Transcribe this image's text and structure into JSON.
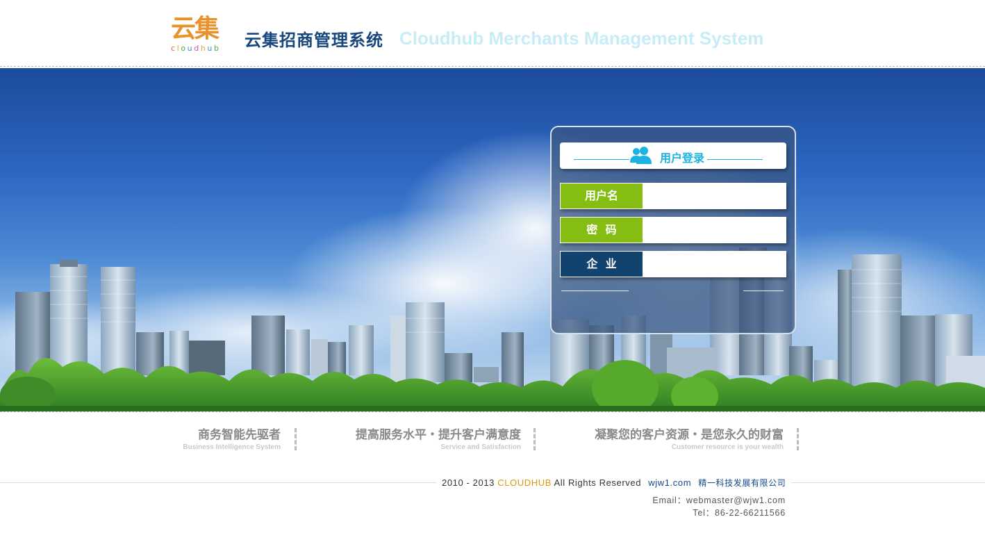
{
  "header": {
    "logo_cn": "云集",
    "logo_en": "cloudhub",
    "system_title_cn": "云集招商管理系统",
    "system_title_en": "Cloudhub Merchants Management System"
  },
  "login": {
    "title": "用户登录",
    "user_icon": "users-icon",
    "fields": [
      {
        "label": "用户名",
        "value": "",
        "color": "#86bd12"
      },
      {
        "label": "密  码",
        "value": "",
        "color": "#86bd12"
      },
      {
        "label": "企  业",
        "value": "",
        "color": "#12436f"
      }
    ]
  },
  "slogans": [
    {
      "cn": "商务智能先驱者",
      "en": "Business Intelligence System"
    },
    {
      "cn": "提高服务水平・提升客户满意度",
      "en": "Service and Satisfaction"
    },
    {
      "cn": "凝聚您的客户资源・是您永久的财富",
      "en": "Customer resource is your wealth"
    }
  ],
  "footer": {
    "years": "2010 - 2013",
    "brand": "CLOUDHUB",
    "rights": "All Rights Reserved",
    "site": "wjw1.com",
    "company": "精一科技发展有限公司",
    "email": "Email：webmaster@wjw1.com",
    "tel": "Tel：86-22-66211566"
  },
  "colors": {
    "accent_green": "#86bd12",
    "accent_navy": "#12436f",
    "title_cyan": "#1ab3e4",
    "brand_gold": "#d89a10"
  }
}
